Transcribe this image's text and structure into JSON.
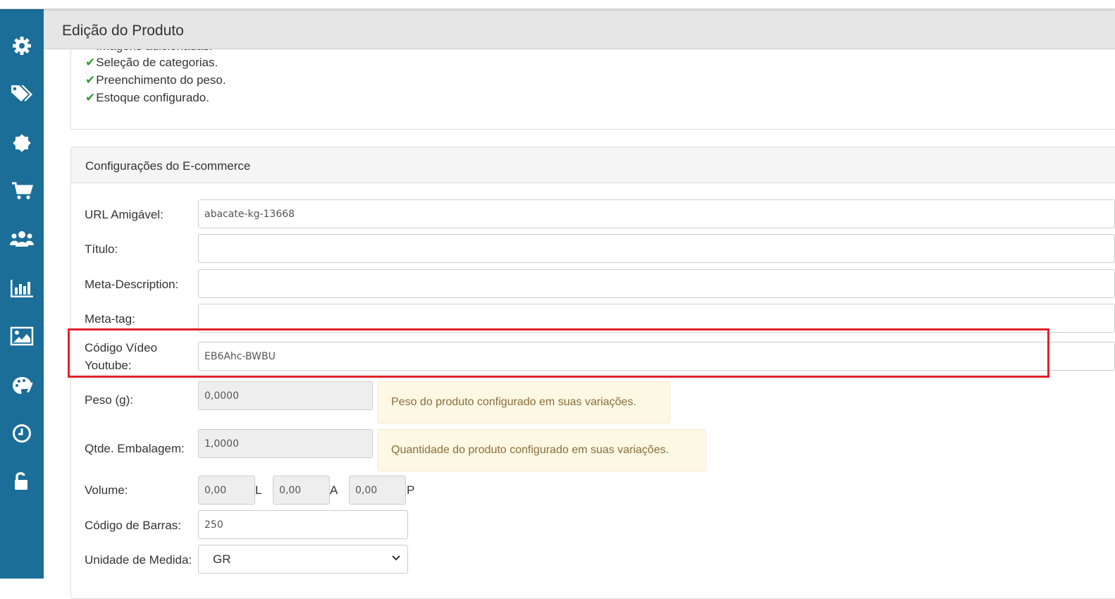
{
  "header": {
    "title": "Edição do Produto"
  },
  "sidebar": {
    "items": [
      {
        "icon": "gear-icon"
      },
      {
        "icon": "tags-icon"
      },
      {
        "icon": "badge-icon"
      },
      {
        "icon": "cart-icon"
      },
      {
        "icon": "users-icon"
      },
      {
        "icon": "bar-chart-icon"
      },
      {
        "icon": "image-icon"
      },
      {
        "icon": "palette-icon"
      },
      {
        "icon": "clock-icon"
      },
      {
        "icon": "unlock-icon"
      }
    ]
  },
  "checklist": {
    "items": [
      "Imagens adicionadas.",
      "Seleção de categorias.",
      "Preenchimento do peso.",
      "Estoque configurado."
    ]
  },
  "ecommerce": {
    "title": "Configurações do E-commerce",
    "url_label": "URL Amigável:",
    "url_value": "abacate-kg-13668",
    "titulo_label": "Título:",
    "titulo_value": "",
    "meta_description_label": "Meta-Description:",
    "meta_description_value": "",
    "meta_tag_label": "Meta-tag:",
    "meta_tag_value": "",
    "video_label_line1": "Código Vídeo",
    "video_label_line2": "Youtube:",
    "video_value": "EB6Ahc-BWBU",
    "peso_label": "Peso (g):",
    "peso_value": "0,0000",
    "peso_hint": "Peso do produto configurado em suas variações.",
    "embalagem_label": "Qtde. Embalagem:",
    "embalagem_value": "1,0000",
    "embalagem_hint": "Quantidade do produto configurado em suas variações.",
    "volume_label": "Volume:",
    "volume_l": "0,00",
    "volume_l_unit": "L",
    "volume_a": "0,00",
    "volume_a_unit": "A",
    "volume_p": "0,00",
    "volume_p_unit": "P",
    "barras_label": "Código de Barras:",
    "barras_value": "250",
    "unidade_label": "Unidade de Medida:",
    "unidade_value": "GR"
  },
  "colors": {
    "sidebar": "#1a6e98",
    "check": "#2e9e2e",
    "highlight": "#e3202a",
    "hint_bg": "#fcf8e3"
  }
}
